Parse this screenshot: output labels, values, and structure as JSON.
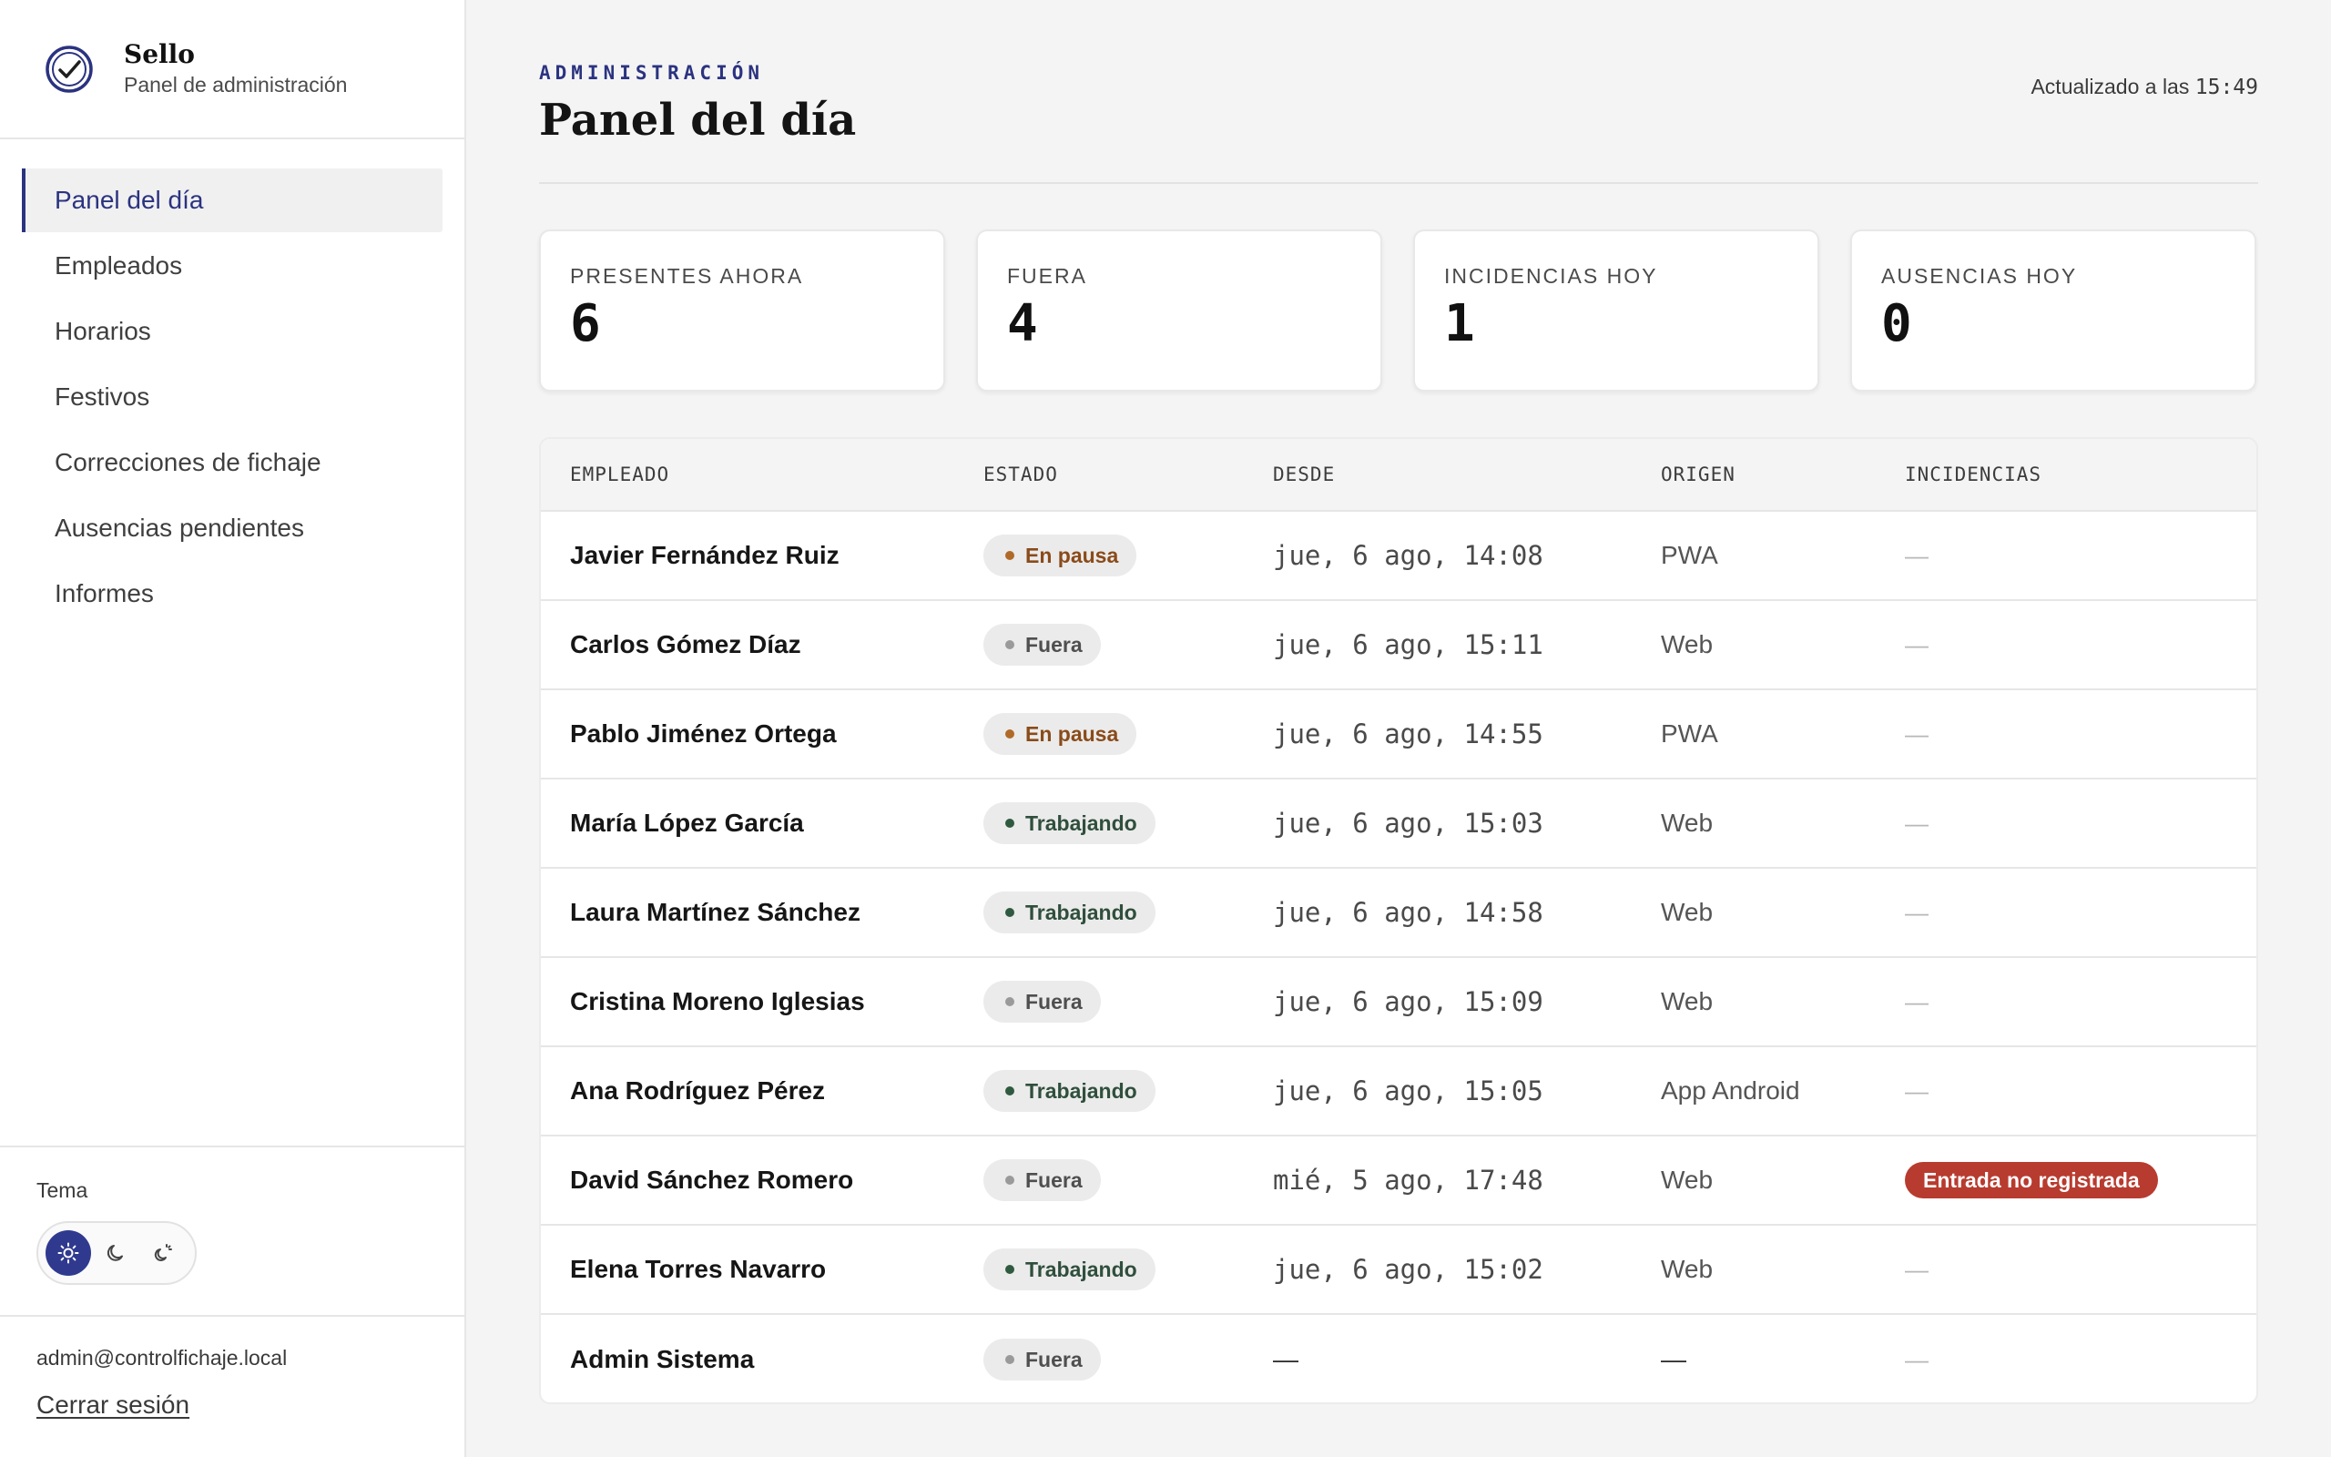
{
  "brand": {
    "name": "Sello",
    "subtitle": "Panel de administración"
  },
  "nav": [
    {
      "label": "Panel del día",
      "active": true
    },
    {
      "label": "Empleados",
      "active": false
    },
    {
      "label": "Horarios",
      "active": false
    },
    {
      "label": "Festivos",
      "active": false
    },
    {
      "label": "Correcciones de fichaje",
      "active": false
    },
    {
      "label": "Ausencias pendientes",
      "active": false
    },
    {
      "label": "Informes",
      "active": false
    }
  ],
  "theme": {
    "label": "Tema",
    "selected": "light",
    "options": [
      "sun-icon",
      "moon-icon",
      "auto-theme-icon"
    ]
  },
  "account": {
    "email": "admin@controlfichaje.local",
    "logout": "Cerrar sesión"
  },
  "header": {
    "eyebrow": "ADMINISTRACIÓN",
    "title": "Panel del día",
    "updated_prefix": "Actualizado a las",
    "updated_time": "15:49"
  },
  "stats": [
    {
      "label": "PRESENTES AHORA",
      "value": "6"
    },
    {
      "label": "FUERA",
      "value": "4"
    },
    {
      "label": "INCIDENCIAS HOY",
      "value": "1"
    },
    {
      "label": "AUSENCIAS HOY",
      "value": "0"
    }
  ],
  "table": {
    "columns": [
      "EMPLEADO",
      "ESTADO",
      "DESDE",
      "ORIGEN",
      "INCIDENCIAS"
    ],
    "rows": [
      {
        "name": "Javier Fernández Ruiz",
        "status": "En pausa",
        "status_kind": "pausa",
        "since": "jue, 6 ago, 14:08",
        "origin": "PWA",
        "incident": "—"
      },
      {
        "name": "Carlos Gómez Díaz",
        "status": "Fuera",
        "status_kind": "fuera",
        "since": "jue, 6 ago, 15:11",
        "origin": "Web",
        "incident": "—"
      },
      {
        "name": "Pablo Jiménez Ortega",
        "status": "En pausa",
        "status_kind": "pausa",
        "since": "jue, 6 ago, 14:55",
        "origin": "PWA",
        "incident": "—"
      },
      {
        "name": "María López García",
        "status": "Trabajando",
        "status_kind": "trab",
        "since": "jue, 6 ago, 15:03",
        "origin": "Web",
        "incident": "—"
      },
      {
        "name": "Laura Martínez Sánchez",
        "status": "Trabajando",
        "status_kind": "trab",
        "since": "jue, 6 ago, 14:58",
        "origin": "Web",
        "incident": "—"
      },
      {
        "name": "Cristina Moreno Iglesias",
        "status": "Fuera",
        "status_kind": "fuera",
        "since": "jue, 6 ago, 15:09",
        "origin": "Web",
        "incident": "—"
      },
      {
        "name": "Ana Rodríguez Pérez",
        "status": "Trabajando",
        "status_kind": "trab",
        "since": "jue, 6 ago, 15:05",
        "origin": "App Android",
        "incident": "—"
      },
      {
        "name": "David Sánchez Romero",
        "status": "Fuera",
        "status_kind": "fuera",
        "since": "mié, 5 ago, 17:48",
        "origin": "Web",
        "incident": "Entrada no registrada",
        "incident_alert": true
      },
      {
        "name": "Elena Torres Navarro",
        "status": "Trabajando",
        "status_kind": "trab",
        "since": "jue, 6 ago, 15:02",
        "origin": "Web",
        "incident": "—"
      },
      {
        "name": "Admin Sistema",
        "status": "Fuera",
        "status_kind": "fuera",
        "since": "—",
        "origin": "—",
        "incident": "—"
      }
    ]
  },
  "colors": {
    "accent": "#2b3380",
    "alert": "#b83b2f",
    "pausa": "#b06a28",
    "trabajando": "#2f5a3f",
    "fuera": "#9a9a9a"
  }
}
